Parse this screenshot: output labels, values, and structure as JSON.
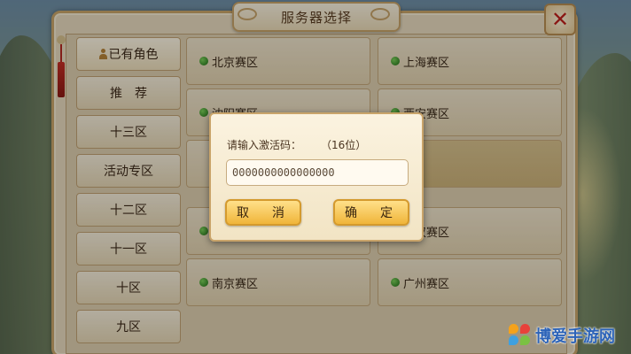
{
  "window": {
    "title": "服务器选择"
  },
  "sidebar": {
    "items": [
      {
        "label": "已有角色",
        "active": true
      },
      {
        "label": "推　荐"
      },
      {
        "label": "十三区"
      },
      {
        "label": "活动专区"
      },
      {
        "label": "十二区"
      },
      {
        "label": "十一区"
      },
      {
        "label": "十区"
      },
      {
        "label": "九区"
      }
    ]
  },
  "servers": [
    {
      "name": "北京赛区",
      "status": "green"
    },
    {
      "name": "上海赛区",
      "status": "green"
    },
    {
      "name": "沈阳赛区",
      "status": "green"
    },
    {
      "name": "西安赛区",
      "status": "green"
    },
    {
      "name": "",
      "status": ""
    },
    {
      "name": "",
      "status": ""
    },
    {
      "name": "",
      "status": "green"
    },
    {
      "name": "武汉赛区",
      "status": "green"
    },
    {
      "name": "南京赛区",
      "status": "green"
    },
    {
      "name": "广州赛区",
      "status": "green"
    }
  ],
  "dialog": {
    "prompt": "请输入激活码：",
    "hint": "（16位）",
    "input_value": "0000000000000000",
    "cancel_label": "取　消",
    "confirm_label": "确　定"
  },
  "watermark": {
    "text": "博爱手游网"
  },
  "colors": {
    "status_online": "#3fa32c",
    "button_gold": "#f0b53a",
    "close_red": "#c0211b"
  }
}
